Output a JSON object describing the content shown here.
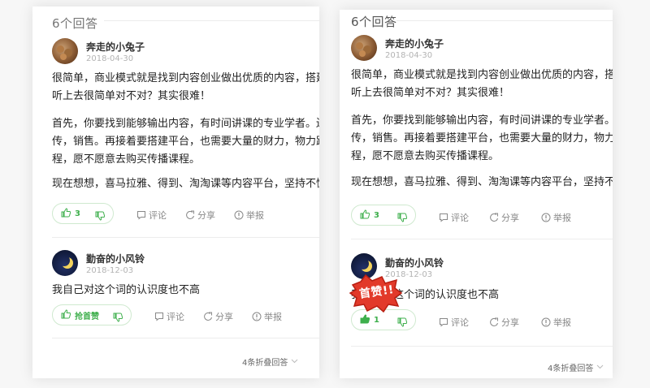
{
  "colors": {
    "accent_green": "#3eaf4c",
    "badge_red": "#e23a2a",
    "muted": "#888888"
  },
  "panels": [
    {
      "answer_count": "6个回答",
      "answers": [
        {
          "username": "奔走的小兔子",
          "date": "2018-04-30",
          "avatar_icon": "food-avatar",
          "paragraphs": [
            [
              "很简单，商业模式就是找到内容创业做出优质的内容，搭建一",
              "听上去很简单对不对？其实很难！"
            ],
            [
              "首先，你要找到能够输出内容，有时间讲课的专业学者。还要",
              "传，销售。再接着要搭建平台，也需要大量的财力，物力跟时",
              "程，愿不愿意去购买传播课程。"
            ],
            [
              "现在想想，喜马拉雅、得到、淘淘课等内容平台，坚持不懈的"
            ]
          ],
          "upvote_label": "3",
          "actions": {
            "comment": "评论",
            "share": "分享",
            "report": "举报"
          }
        },
        {
          "username": "勤奋的小风铃",
          "date": "2018-12-03",
          "avatar_icon": "moon-avatar",
          "paragraphs": [
            [
              "我自己对这个词的认识度也不高"
            ]
          ],
          "upvote_label": "抢首赞",
          "actions": {
            "comment": "评论",
            "share": "分享",
            "report": "举报"
          }
        }
      ],
      "collapsed_label": "4条折叠回答"
    },
    {
      "answer_count": "6个回答",
      "answers": [
        {
          "username": "奔走的小兔子",
          "date": "2018-04-30",
          "avatar_icon": "food-avatar",
          "paragraphs": [
            [
              "很简单，商业模式就是找到内容创业做出优质的内容，搭建",
              "听上去很简单对不对？其实很难！"
            ],
            [
              "首先，你要找到能够输出内容，有时间讲课的专业学者。还",
              "传，销售。再接着要搭建平台，也需要大量的财力，物力跟",
              "程，愿不愿意去购买传播课程。"
            ],
            [
              "现在想想，喜马拉雅、得到、淘淘课等内容平台，坚持不懈"
            ]
          ],
          "upvote_label": "3",
          "actions": {
            "comment": "评论",
            "share": "分享",
            "report": "举报"
          }
        },
        {
          "username": "勤奋的小风铃",
          "date": "2018-12-03",
          "avatar_icon": "moon-avatar",
          "paragraphs": [
            [
              "我自己对这个词的认识度也不高"
            ]
          ],
          "upvote_label": "1",
          "actions": {
            "comment": "评论",
            "share": "分享",
            "report": "举报"
          }
        }
      ],
      "collapsed_label": "4条折叠回答"
    }
  ],
  "first_like_badge": "首赞!!"
}
